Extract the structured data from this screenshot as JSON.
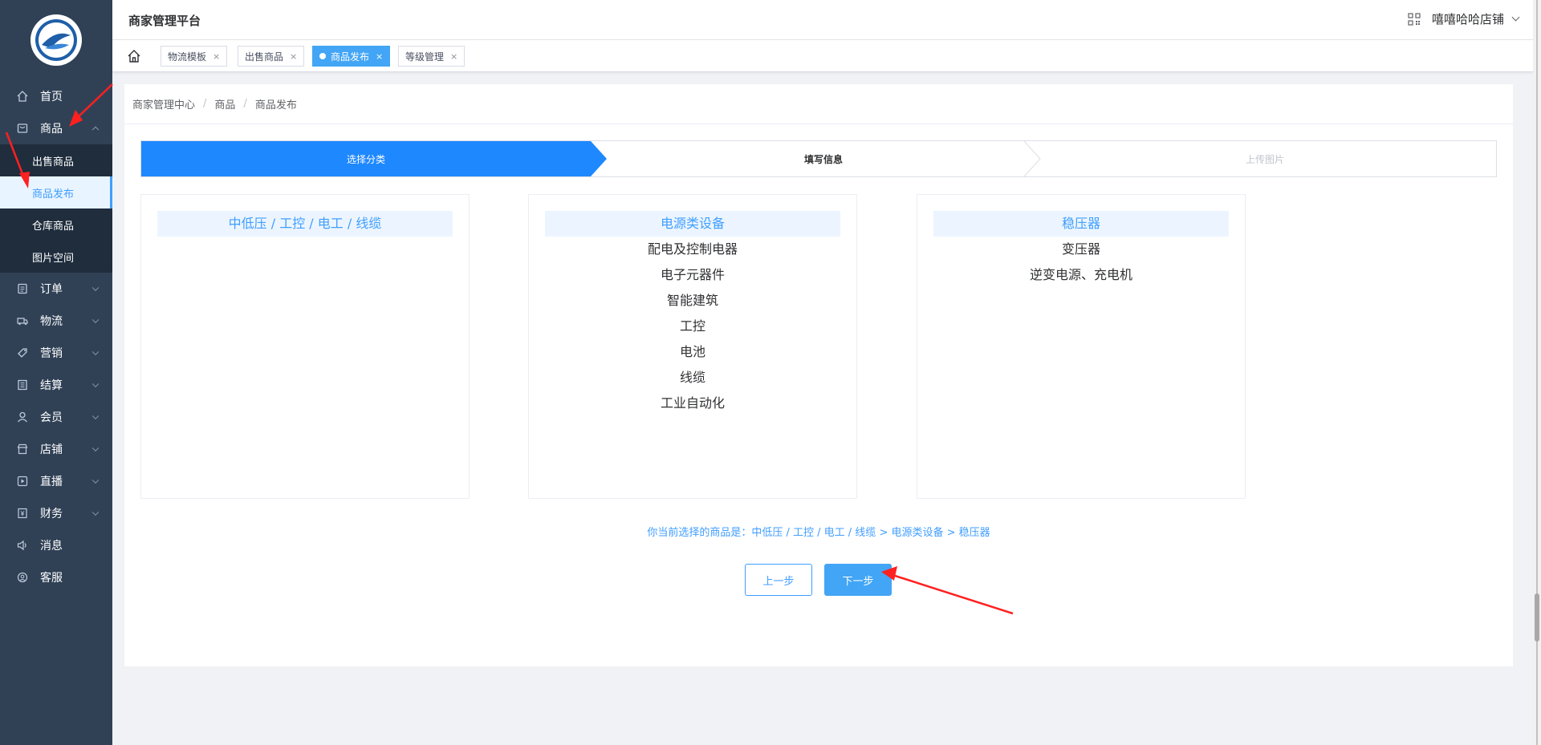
{
  "header": {
    "title": "商家管理平台",
    "shop_name": "嘻嘻哈哈店铺"
  },
  "sidebar": {
    "items": [
      {
        "label": "首页",
        "icon": "home-icon"
      },
      {
        "label": "商品",
        "icon": "goods-icon",
        "expanded": true
      },
      {
        "label": "订单",
        "icon": "order-icon"
      },
      {
        "label": "物流",
        "icon": "truck-icon"
      },
      {
        "label": "营销",
        "icon": "tag-icon"
      },
      {
        "label": "结算",
        "icon": "ledger-icon"
      },
      {
        "label": "会员",
        "icon": "user-icon"
      },
      {
        "label": "店铺",
        "icon": "store-icon"
      },
      {
        "label": "直播",
        "icon": "live-icon"
      },
      {
        "label": "财务",
        "icon": "finance-icon"
      },
      {
        "label": "消息",
        "icon": "speaker-icon"
      },
      {
        "label": "客服",
        "icon": "service-icon"
      }
    ],
    "goods_sub": [
      {
        "label": "出售商品",
        "active": false
      },
      {
        "label": "商品发布",
        "active": true
      },
      {
        "label": "仓库商品",
        "active": false
      },
      {
        "label": "图片空间",
        "active": false
      }
    ]
  },
  "tags": [
    {
      "label": "物流模板",
      "close": "×",
      "active": false
    },
    {
      "label": "出售商品",
      "close": "×",
      "active": false
    },
    {
      "label": "商品发布",
      "close": "×",
      "active": true
    },
    {
      "label": "等级管理",
      "close": "×",
      "active": false
    }
  ],
  "breadcrumb": [
    "商家管理中心",
    "商品",
    "商品发布"
  ],
  "breadcrumb_sep": "/",
  "steps": [
    "选择分类",
    "填写信息",
    "上传图片"
  ],
  "categories": {
    "level1": [
      "中低压 / 工控 / 电工 / 线缆"
    ],
    "level2": [
      "电源类设备",
      "配电及控制电器",
      "电子元器件",
      "智能建筑",
      "工控",
      "电池",
      "线缆",
      "工业自动化"
    ],
    "level3": [
      "稳压器",
      "变压器",
      "逆变电源、充电机"
    ]
  },
  "selected_text": "你当前选择的商品是：中低压 / 工控 / 电工 / 线缆 > 电源类设备 > 稳压器",
  "buttons": {
    "prev": "上一步",
    "next": "下一步"
  },
  "colors": {
    "sidebar_bg": "#304156",
    "primary": "#409eff",
    "step_active": "#1e88ff",
    "annotation_arrow": "#ff2020"
  }
}
